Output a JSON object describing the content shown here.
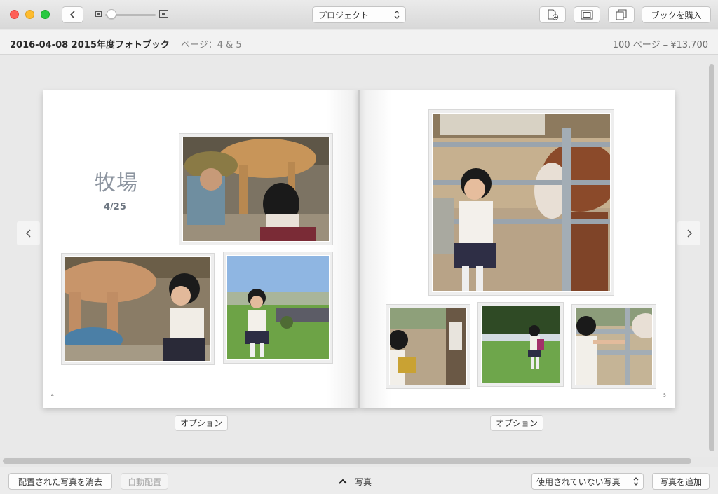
{
  "window": {
    "project_select": "プロジェクト",
    "buy_button": "ブックを購入"
  },
  "info": {
    "book_title": "2016-04-08 2015年度フォトブック",
    "pages": "ページ：4 & 5",
    "price": "100 ページ – ¥13,700"
  },
  "left_page": {
    "title": "牧場",
    "date": "4/25",
    "page_number": "4",
    "option_label": "オプション"
  },
  "right_page": {
    "page_number": "5",
    "option_label": "オプション"
  },
  "bottom": {
    "clear_button": "配置された写真を消去",
    "auto_button": "自動配置",
    "photos_label": "写真",
    "unused_select": "使用されていない写真",
    "add_button": "写真を追加"
  },
  "icons": {
    "back": "chevron-left-icon",
    "zoom_small": "zoom-out-icon",
    "zoom_large": "zoom-in-icon",
    "add_page": "add-page-icon",
    "layout": "layout-icon",
    "copy": "duplicate-page-icon",
    "prev": "chevron-left-icon",
    "next": "chevron-right-icon",
    "expand": "chevron-up-icon"
  },
  "colors": {
    "title_text": "#8d95a0",
    "close": "#fe5f57",
    "minimize": "#febc2e",
    "zoom": "#28c840"
  }
}
